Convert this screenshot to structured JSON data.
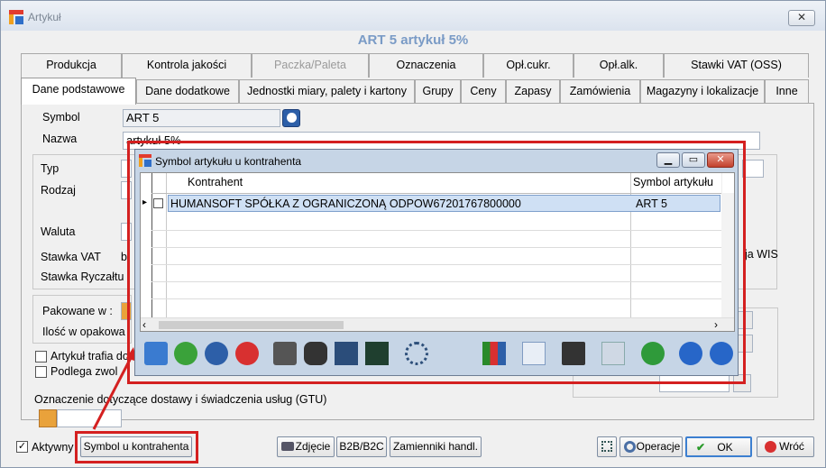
{
  "window": {
    "title": "Artykuł",
    "close_symbol": "✕",
    "heading": "ART 5  artykuł 5%"
  },
  "tabs_row1": [
    {
      "label": "Produkcja",
      "disabled": false
    },
    {
      "label": "Kontrola jakości",
      "disabled": false
    },
    {
      "label": "Paczka/Paleta",
      "disabled": true
    },
    {
      "label": "Oznaczenia",
      "disabled": false
    },
    {
      "label": "Opł.cukr.",
      "disabled": false
    },
    {
      "label": "Opł.alk.",
      "disabled": false
    },
    {
      "label": "Stawki VAT (OSS)",
      "disabled": false
    }
  ],
  "tabs_row2": [
    {
      "label": "Dane podstawowe",
      "active": true
    },
    {
      "label": "Dane dodatkowe"
    },
    {
      "label": "Jednostki miary, palety i kartony"
    },
    {
      "label": "Grupy"
    },
    {
      "label": "Ceny"
    },
    {
      "label": "Zapasy"
    },
    {
      "label": "Zamówienia"
    },
    {
      "label": "Magazyny i lokalizacje"
    },
    {
      "label": "Inne"
    }
  ],
  "form": {
    "symbol_label": "Symbol",
    "symbol_value": "ART 5",
    "nazwa_label": "Nazwa",
    "nazwa_value": "artykuł 5%",
    "typ_label": "Typ",
    "rodzaj_label": "Rodzaj",
    "waluta_label": "Waluta",
    "stawka_vat_label": "Stawka VAT",
    "stawka_vat_value": "b",
    "stawka_ryczaltu_label": "Stawka Ryczałtu",
    "wis_partial": "ja WIS",
    "pakowane_label": "Pakowane w :",
    "ilosc_label": "Ilość w opakowa",
    "artykul_trafia_label": "Artykuł trafia do",
    "podlega_label": "Podlega zwol",
    "gtu_label": "Oznaczenie dotyczące dostawy i świadczenia usług (GTU)",
    "aktywny_label": "Aktywny",
    "aktywny_checked": true
  },
  "bottom_buttons": {
    "symbol_kontrahenta": "Symbol u kontrahenta",
    "zdjecie": "Zdjęcie",
    "b2b": "B2B/B2C",
    "zamienniki": "Zamienniki handl.",
    "operacje": "Operacje",
    "ok": "OK",
    "wroc": "Wróć"
  },
  "dialog": {
    "title": "Symbol artykułu u kontrahenta",
    "min_symbol": "▁",
    "max_symbol": "▭",
    "close_symbol": "✕",
    "columns": [
      "Kontrahent",
      "Symbol artykułu"
    ],
    "rows": [
      {
        "kontrahent": "HUMANSOFT SPÓŁKA Z OGRANICZONĄ ODPOW67201767800000",
        "symbol": "ART 5"
      }
    ],
    "row_marker": "▸",
    "scroll_left": "‹",
    "scroll_right": "›",
    "toolbar_icons": [
      "exit-icon",
      "add-icon",
      "search-icon",
      "delete-icon",
      "print-icon",
      "binoculars-icon",
      "library-icon",
      "calc-icon",
      "filter-icon",
      "chart-icon",
      "list-doc-icon",
      "save-icon",
      "copy-icon",
      "refresh-icon",
      "first-icon",
      "last-icon"
    ]
  },
  "colors": {
    "heading": "#7a9bc6",
    "highlight_box": "#d42020",
    "selected_row": "#cfe0f4"
  }
}
